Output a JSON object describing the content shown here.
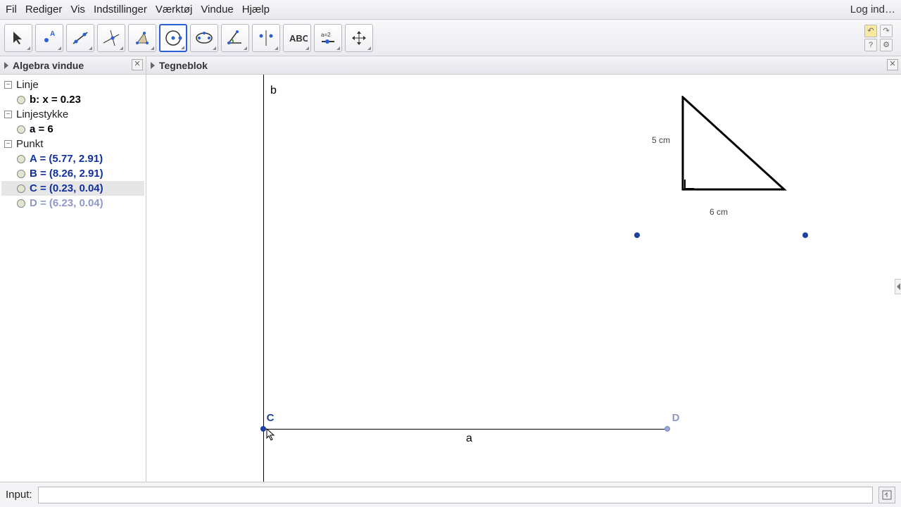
{
  "menu": {
    "items": [
      "Fil",
      "Rediger",
      "Vis",
      "Indstillinger",
      "Værktøj",
      "Vindue",
      "Hjælp"
    ],
    "login": "Log ind…"
  },
  "toolbar": {
    "tools": [
      "move",
      "point",
      "line",
      "perpendicular",
      "polygon",
      "circle",
      "ellipse",
      "angle",
      "reflect",
      "text",
      "slider",
      "pan"
    ],
    "selected_index": 5
  },
  "panels": {
    "algebra_title": "Algebra vindue",
    "graphics_title": "Tegneblok"
  },
  "algebra": {
    "categories": [
      {
        "name": "Linje",
        "items": [
          {
            "label": "b: x = 0.23",
            "style": "black"
          }
        ]
      },
      {
        "name": "Linjestykke",
        "items": [
          {
            "label": "a = 6",
            "style": "black"
          }
        ]
      },
      {
        "name": "Punkt",
        "items": [
          {
            "label": "A = (5.77, 2.91)",
            "style": "blue"
          },
          {
            "label": "B = (8.26, 2.91)",
            "style": "blue"
          },
          {
            "label": "C = (0.23, 0.04)",
            "style": "blue",
            "selected": true
          },
          {
            "label": "D = (6.23, 0.04)",
            "style": "grey"
          }
        ]
      }
    ]
  },
  "graphics": {
    "axis_b_label": "b",
    "segment_a_label": "a",
    "points": {
      "C": "C",
      "D": "D"
    },
    "triangle": {
      "side_v": "5 cm",
      "side_h": "6 cm"
    }
  },
  "inputbar": {
    "label": "Input:",
    "value": ""
  }
}
